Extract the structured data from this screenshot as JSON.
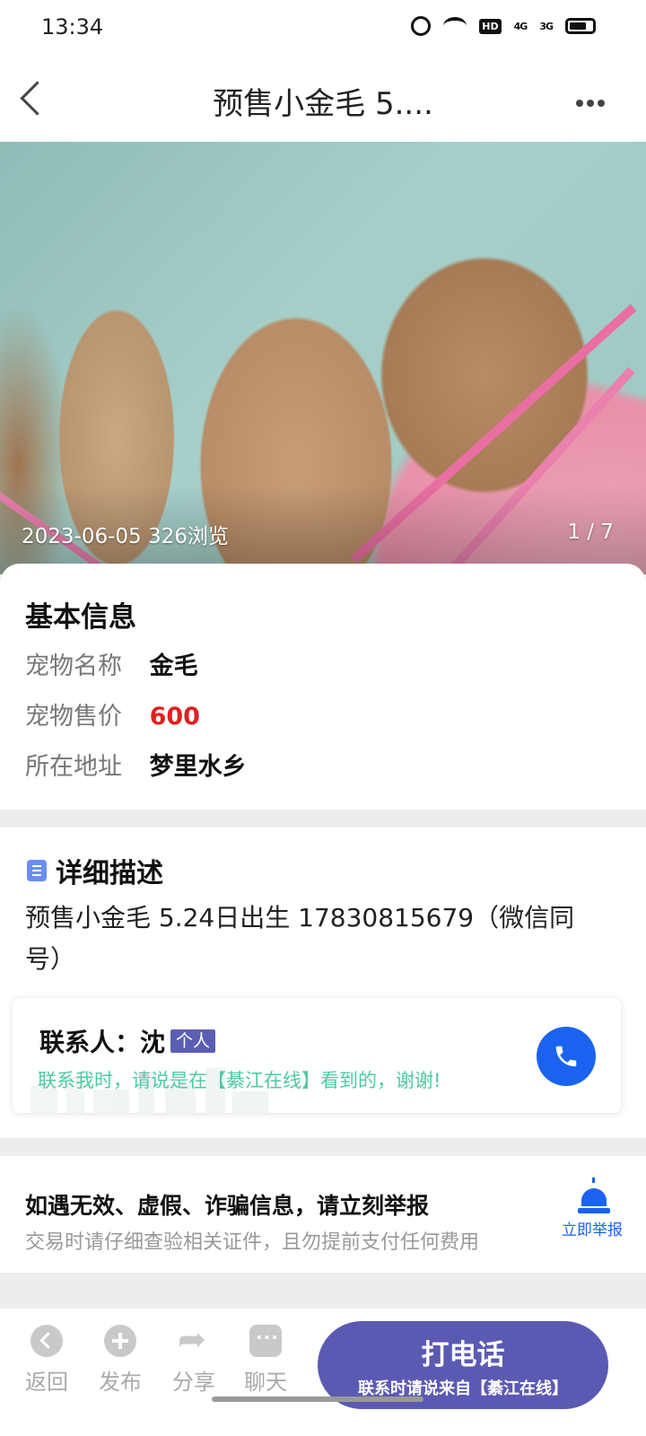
{
  "status_bar": {
    "time": "13:34",
    "icons": [
      "alarm-icon",
      "wifi-icon",
      "hd-icon",
      "signal-4g-icon",
      "signal-3g-icon",
      "battery-icon"
    ],
    "hd_label": "HD",
    "sig4g_label": "4G",
    "sig3g_label": "3G"
  },
  "nav": {
    "title": "预售小金毛 5....",
    "back_icon": "chevron-left-icon",
    "more_icon": "more-dots-icon"
  },
  "photo": {
    "date": "2023-06-05",
    "views": "326浏览",
    "counter": "1 / 7"
  },
  "basic_info": {
    "title": "基本信息",
    "rows": [
      {
        "label": "宠物名称",
        "value": "金毛"
      },
      {
        "label": "宠物售价",
        "value": "600"
      },
      {
        "label": "所在地址",
        "value": "梦里水乡"
      }
    ]
  },
  "detail": {
    "title": "详细描述",
    "text": "预售小金毛 5.24日出生 17830815679（微信同号）"
  },
  "contact": {
    "label": "联系人：",
    "name": "沈",
    "badge": "个人",
    "hint": "联系我时，请说是在【綦江在线】看到的，谢谢!"
  },
  "report": {
    "title": "如遇无效、虚假、诈骗信息，请立刻举报",
    "subtitle": "交易时请仔细查验相关证件，且勿提前支付任何费用",
    "button_label": "立即举报"
  },
  "bottom_bar": {
    "items": [
      {
        "label": "返回",
        "icon": "back-icon"
      },
      {
        "label": "发布",
        "icon": "plus-icon"
      },
      {
        "label": "分享",
        "icon": "share-icon"
      },
      {
        "label": "聊天",
        "icon": "chat-icon"
      }
    ],
    "call_label": "打电话",
    "call_sub": "联系时请说来自【綦江在线】"
  },
  "colors": {
    "accent": "#5b5ab3",
    "call_blue": "#1a63f0",
    "price_red": "#e02020",
    "hint_green": "#4fc9a4"
  }
}
